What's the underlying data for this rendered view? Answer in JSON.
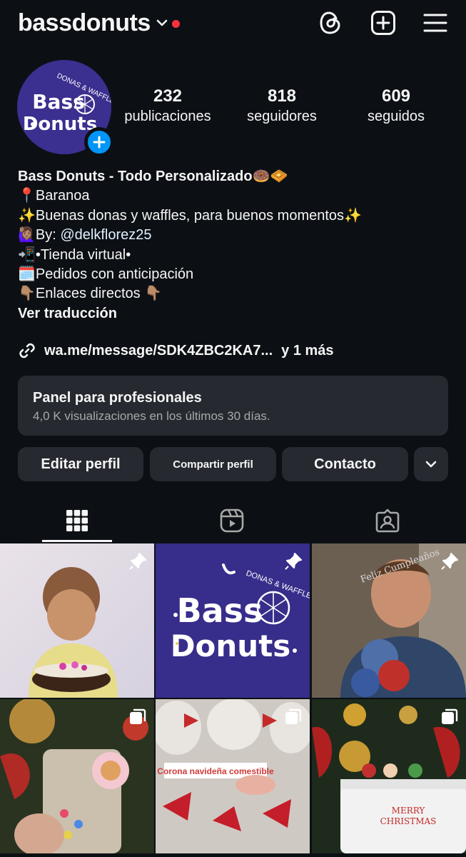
{
  "header": {
    "username": "bassdonuts",
    "icons": [
      "chevron-down-icon",
      "notification-dot",
      "threads-icon",
      "new-post-icon",
      "menu-icon"
    ]
  },
  "profile": {
    "avatar_brand_top": "DONAS & WAFFLES",
    "avatar_brand": "Bass Donuts",
    "stats": [
      {
        "value": "232",
        "label": "publicaciones"
      },
      {
        "value": "818",
        "label": "seguidores"
      },
      {
        "value": "609",
        "label": "seguidos"
      }
    ]
  },
  "bio": {
    "name": "Bass Donuts - Todo Personalizado🍩🧇",
    "lines": [
      {
        "emoji": "📍",
        "text": "Baranoa"
      },
      {
        "emoji": "✨",
        "text": "Buenas donas y waffles, para buenos momentos✨"
      },
      {
        "emoji": "🙋🏽‍♀️",
        "prefix": "By: ",
        "handle": "@delkflorez25"
      },
      {
        "emoji": "📲",
        "text": "•Tienda virtual•"
      },
      {
        "emoji": "🗓️",
        "text": "Pedidos con anticipación"
      },
      {
        "emoji": "👇🏽",
        "text": "Enlaces directos 👇🏽"
      }
    ],
    "translate": "Ver traducción"
  },
  "link": {
    "url": "wa.me/message/SDK4ZBC2KA7...",
    "more": "y 1 más"
  },
  "dashboard": {
    "title": "Panel para profesionales",
    "subtitle": "4,0 K visualizaciones en los últimos 30 días."
  },
  "buttons": {
    "edit": "Editar perfil",
    "share": "Compartir perfil",
    "contact": "Contacto"
  },
  "tabs": [
    "grid-icon",
    "reels-icon",
    "tagged-icon"
  ],
  "posts": [
    {
      "subject": "toddler with decorated cake",
      "badge": "pin-icon"
    },
    {
      "subject": "Bass Donuts logo",
      "badge": "pin-icon",
      "logo_top": "DONAS & WAFFLES",
      "logo_line1": "Bass",
      "logo_line2": "Donuts"
    },
    {
      "subject": "boy with superhero cake",
      "badge": "pin-icon",
      "topper": "Feliz Cumpleaños"
    },
    {
      "subject": "christmas gift bag",
      "badge": "carousel-icon"
    },
    {
      "subject": "wrapped sweets",
      "badge": "carousel-icon",
      "caption": "Corona navideña comestible"
    },
    {
      "subject": "christmas box",
      "badge": "carousel-icon",
      "box_text_1": "MERRY",
      "box_text_2": "CHRISTMAS"
    }
  ],
  "colors": {
    "background": "#0c1014",
    "surface": "#262a30",
    "accent": "#0095f6",
    "notification": "#ff3040",
    "link_handle": "#e0f1ff"
  }
}
